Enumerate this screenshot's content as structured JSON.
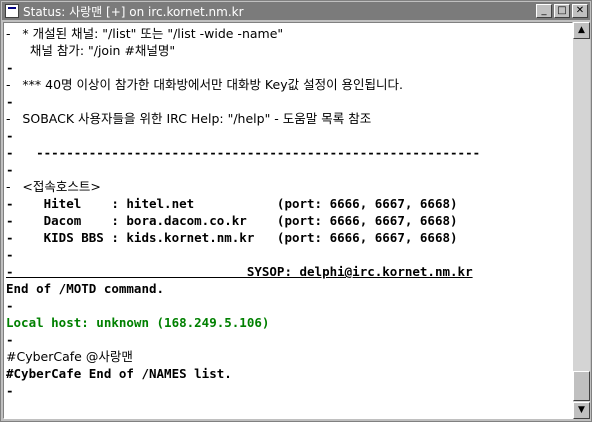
{
  "window": {
    "title": "Status: 사랑맨 [+] on irc.kornet.nm.kr"
  },
  "titlebar_buttons": {
    "minimize": "_",
    "maximize": "□",
    "close": "✕"
  },
  "scrollbar": {
    "up": "▲",
    "down": "▼",
    "position": 0.95
  },
  "lines": [
    "-   * 개설된 채널: \"/list\" 또는 \"/list -wide -name\"",
    "      채널 참가: \"/join #채널명\"",
    "-",
    "-   *** 40명 이상이 참가한 대화방에서만 대화방 Key값 설정이 용인됩니다.",
    "-",
    "-   SOBACK 사용자들을 위한 IRC Help: \"/help\" - 도움말 목록 참조",
    "-",
    "-   -----------------------------------------------------------",
    "-",
    "-   <접속호스트>",
    "-    Hitel    : hitel.net           (port: 6666, 6667, 6668)",
    "-    Dacom    : bora.dacom.co.kr    (port: 6666, 6667, 6668)",
    "-    KIDS BBS : kids.kornet.nm.kr   (port: 6666, 6667, 6668)",
    "-",
    "-                               SYSOP: delphi@irc.kornet.nm.kr",
    "End of /MOTD command.",
    "-",
    "Local host: unknown (168.249.5.106)",
    "-",
    "#CyberCafe @사랑맨",
    "#CyberCafe End of /NAMES list.",
    "-"
  ],
  "colors": {
    "green_text": "#008000",
    "title_bg": "#7b7b7b"
  }
}
